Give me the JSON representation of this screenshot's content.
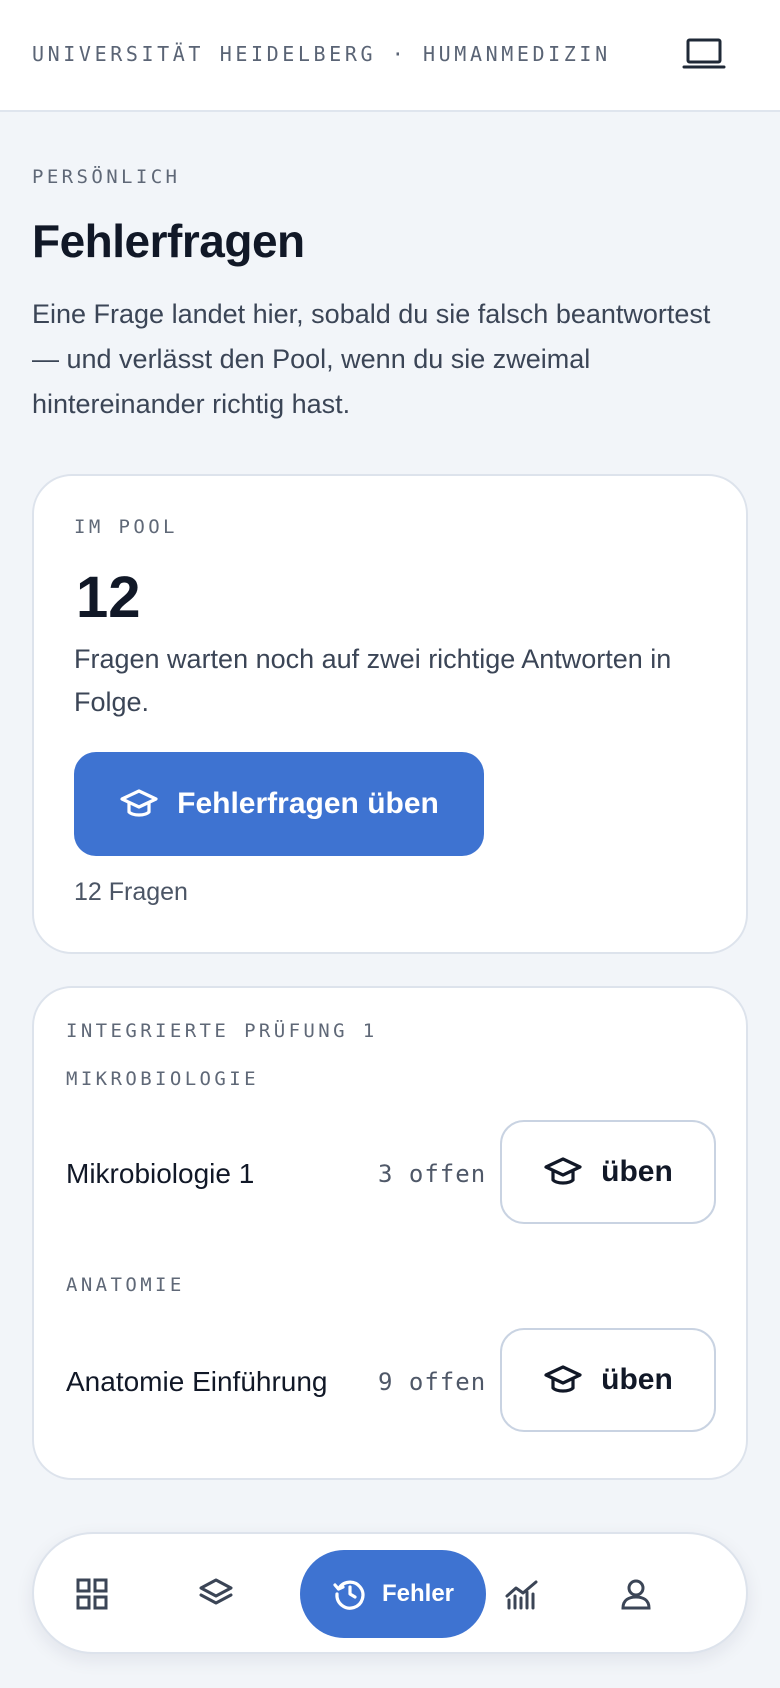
{
  "header": {
    "brand": "UNIVERSITÄT HEIDELBERG · HUMANMEDIZIN",
    "device_icon": "laptop-icon"
  },
  "page": {
    "eyebrow": "PERSÖNLICH",
    "title": "Fehlerfragen",
    "intro": "Eine Frage landet hier, sobald du sie falsch beantwortest — und verlässt den Pool, wenn du sie zweimal hintereinander richtig hast."
  },
  "pool": {
    "label": "IM POOL",
    "count": "12",
    "description": "Fragen warten noch auf zwei richtige Antworten in Folge.",
    "practice_button": "Fehlerfragen üben",
    "practice_icon": "graduation-cap-icon",
    "subtext": "12 Fragen"
  },
  "exam": {
    "label": "INTEGRIERTE PRÜFUNG 1",
    "groups": [
      {
        "subject": "MIKROBIOLOGIE",
        "items": [
          {
            "name": "Mikrobiologie 1",
            "open": "3 offen",
            "button": "üben"
          }
        ]
      },
      {
        "subject": "ANATOMIE",
        "items": [
          {
            "name": "Anatomie Einführung",
            "open": "9 offen",
            "button": "üben"
          }
        ]
      }
    ]
  },
  "nav": {
    "items": [
      {
        "icon": "grid-icon"
      },
      {
        "icon": "layers-icon"
      },
      {
        "icon": "history-icon",
        "label": "Fehler",
        "active": true
      },
      {
        "icon": "chart-icon"
      },
      {
        "icon": "user-icon"
      }
    ]
  },
  "colors": {
    "accent": "#3e73d1",
    "background": "#f2f5f9",
    "text": "#111827",
    "muted": "#5f6877"
  }
}
